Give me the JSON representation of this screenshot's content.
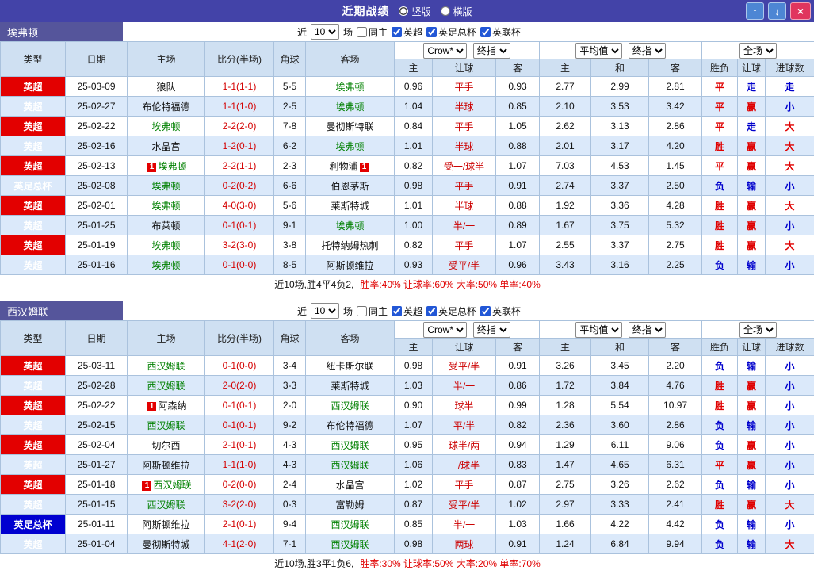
{
  "titlebar": {
    "title": "近期战绩",
    "vertical_label": "竖版",
    "horizontal_label": "横版",
    "vertical_checked": true,
    "horizontal_checked": false,
    "up_icon": "↑",
    "down_icon": "↓",
    "close_icon": "×"
  },
  "filter": {
    "near_label": "近",
    "count": "10",
    "games_label": "场",
    "same_home_label": "同主",
    "same_home_checked": false,
    "leagues": [
      {
        "label": "英超",
        "checked": true
      },
      {
        "label": "英足总杯",
        "checked": true
      },
      {
        "label": "英联杯",
        "checked": true
      }
    ]
  },
  "selects": {
    "asian_company": "Crow*",
    "asian_time": "终指",
    "euro_company": "平均值",
    "euro_time": "终指",
    "scope": "全场"
  },
  "columns": [
    "类型",
    "日期",
    "主场",
    "比分(半场)",
    "角球",
    "客场",
    "主",
    "让球",
    "客",
    "主",
    "和",
    "客",
    "胜负",
    "让球",
    "进球数"
  ],
  "colors": {
    "titlebar_bg": "#4343a8",
    "team_band_bg": "#55559b",
    "header_bg": "#cfe0f2",
    "alt_row_bg": "#dbe9fa",
    "league_red": "#e30000",
    "league_blue": "#0000d0",
    "focus_team_green": "#008000",
    "score_red": "#d40000",
    "handicap_red": "#cc0000",
    "result_red": "#e00000",
    "result_blue": "#0000cc"
  },
  "result_colors": {
    "胜": "#e00000",
    "平": "#e00000",
    "负": "#0000cc",
    "赢": "#e00000",
    "输": "#0000cc",
    "走": "#0000cc",
    "大": "#e00000",
    "小": "#0000cc"
  },
  "sections": [
    {
      "team": "埃弗顿",
      "rows": [
        {
          "league": "英超",
          "league_color": "red",
          "date": "25-03-09",
          "home": "狼队",
          "home_focus": false,
          "home_card": "",
          "score": "1-1(1-1)",
          "corners": "5-5",
          "away": "埃弗顿",
          "away_focus": true,
          "away_card": "",
          "asian_home": "0.96",
          "handicap": "平手",
          "asian_away": "0.93",
          "euro_home": "2.77",
          "euro_draw": "2.99",
          "euro_away": "2.81",
          "result": "平",
          "handicap_result": "走",
          "goals_result": "走"
        },
        {
          "league": "英超",
          "league_color": "red",
          "date": "25-02-27",
          "home": "布伦特福德",
          "home_focus": false,
          "home_card": "",
          "score": "1-1(1-0)",
          "corners": "2-5",
          "away": "埃弗顿",
          "away_focus": true,
          "away_card": "",
          "asian_home": "1.04",
          "handicap": "半球",
          "asian_away": "0.85",
          "euro_home": "2.10",
          "euro_draw": "3.53",
          "euro_away": "3.42",
          "result": "平",
          "handicap_result": "赢",
          "goals_result": "小"
        },
        {
          "league": "英超",
          "league_color": "red",
          "date": "25-02-22",
          "home": "埃弗顿",
          "home_focus": true,
          "home_card": "",
          "score": "2-2(2-0)",
          "corners": "7-8",
          "away": "曼彻斯特联",
          "away_focus": false,
          "away_card": "",
          "asian_home": "0.84",
          "handicap": "平手",
          "asian_away": "1.05",
          "euro_home": "2.62",
          "euro_draw": "3.13",
          "euro_away": "2.86",
          "result": "平",
          "handicap_result": "走",
          "goals_result": "大"
        },
        {
          "league": "英超",
          "league_color": "red",
          "date": "25-02-16",
          "home": "水晶宫",
          "home_focus": false,
          "home_card": "",
          "score": "1-2(0-1)",
          "corners": "6-2",
          "away": "埃弗顿",
          "away_focus": true,
          "away_card": "",
          "asian_home": "1.01",
          "handicap": "半球",
          "asian_away": "0.88",
          "euro_home": "2.01",
          "euro_draw": "3.17",
          "euro_away": "4.20",
          "result": "胜",
          "handicap_result": "赢",
          "goals_result": "大"
        },
        {
          "league": "英超",
          "league_color": "red",
          "date": "25-02-13",
          "home": "埃弗顿",
          "home_focus": true,
          "home_card": "1",
          "score": "2-2(1-1)",
          "corners": "2-3",
          "away": "利物浦",
          "away_focus": false,
          "away_card": "1",
          "asian_home": "0.82",
          "handicap": "受一/球半",
          "asian_away": "1.07",
          "euro_home": "7.03",
          "euro_draw": "4.53",
          "euro_away": "1.45",
          "result": "平",
          "handicap_result": "赢",
          "goals_result": "大"
        },
        {
          "league": "英足总杯",
          "league_color": "blue",
          "date": "25-02-08",
          "home": "埃弗顿",
          "home_focus": true,
          "home_card": "",
          "score": "0-2(0-2)",
          "corners": "6-6",
          "away": "伯恩茅斯",
          "away_focus": false,
          "away_card": "",
          "asian_home": "0.98",
          "handicap": "平手",
          "asian_away": "0.91",
          "euro_home": "2.74",
          "euro_draw": "3.37",
          "euro_away": "2.50",
          "result": "负",
          "handicap_result": "输",
          "goals_result": "小"
        },
        {
          "league": "英超",
          "league_color": "red",
          "date": "25-02-01",
          "home": "埃弗顿",
          "home_focus": true,
          "home_card": "",
          "score": "4-0(3-0)",
          "corners": "5-6",
          "away": "莱斯特城",
          "away_focus": false,
          "away_card": "",
          "asian_home": "1.01",
          "handicap": "半球",
          "asian_away": "0.88",
          "euro_home": "1.92",
          "euro_draw": "3.36",
          "euro_away": "4.28",
          "result": "胜",
          "handicap_result": "赢",
          "goals_result": "大"
        },
        {
          "league": "英超",
          "league_color": "red",
          "date": "25-01-25",
          "home": "布莱顿",
          "home_focus": false,
          "home_card": "",
          "score": "0-1(0-1)",
          "corners": "9-1",
          "away": "埃弗顿",
          "away_focus": true,
          "away_card": "",
          "asian_home": "1.00",
          "handicap": "半/一",
          "asian_away": "0.89",
          "euro_home": "1.67",
          "euro_draw": "3.75",
          "euro_away": "5.32",
          "result": "胜",
          "handicap_result": "赢",
          "goals_result": "小"
        },
        {
          "league": "英超",
          "league_color": "red",
          "date": "25-01-19",
          "home": "埃弗顿",
          "home_focus": true,
          "home_card": "",
          "score": "3-2(3-0)",
          "corners": "3-8",
          "away": "托特纳姆热刺",
          "away_focus": false,
          "away_card": "",
          "asian_home": "0.82",
          "handicap": "平手",
          "asian_away": "1.07",
          "euro_home": "2.55",
          "euro_draw": "3.37",
          "euro_away": "2.75",
          "result": "胜",
          "handicap_result": "赢",
          "goals_result": "大"
        },
        {
          "league": "英超",
          "league_color": "red",
          "date": "25-01-16",
          "home": "埃弗顿",
          "home_focus": true,
          "home_card": "",
          "score": "0-1(0-0)",
          "corners": "8-5",
          "away": "阿斯顿维拉",
          "away_focus": false,
          "away_card": "",
          "asian_home": "0.93",
          "handicap": "受平/半",
          "asian_away": "0.96",
          "euro_home": "3.43",
          "euro_draw": "3.16",
          "euro_away": "2.25",
          "result": "负",
          "handicap_result": "输",
          "goals_result": "小"
        }
      ],
      "summary": {
        "lead": "近10场,胜4平4负2,",
        "stats": "胜率:40% 让球率:60% 大率:50% 单率:40%"
      }
    },
    {
      "team": "西汉姆联",
      "rows": [
        {
          "league": "英超",
          "league_color": "red",
          "date": "25-03-11",
          "home": "西汉姆联",
          "home_focus": true,
          "home_card": "",
          "score": "0-1(0-0)",
          "corners": "3-4",
          "away": "纽卡斯尔联",
          "away_focus": false,
          "away_card": "",
          "asian_home": "0.98",
          "handicap": "受平/半",
          "asian_away": "0.91",
          "euro_home": "3.26",
          "euro_draw": "3.45",
          "euro_away": "2.20",
          "result": "负",
          "handicap_result": "输",
          "goals_result": "小"
        },
        {
          "league": "英超",
          "league_color": "red",
          "date": "25-02-28",
          "home": "西汉姆联",
          "home_focus": true,
          "home_card": "",
          "score": "2-0(2-0)",
          "corners": "3-3",
          "away": "莱斯特城",
          "away_focus": false,
          "away_card": "",
          "asian_home": "1.03",
          "handicap": "半/一",
          "asian_away": "0.86",
          "euro_home": "1.72",
          "euro_draw": "3.84",
          "euro_away": "4.76",
          "result": "胜",
          "handicap_result": "赢",
          "goals_result": "小"
        },
        {
          "league": "英超",
          "league_color": "red",
          "date": "25-02-22",
          "home": "阿森纳",
          "home_focus": false,
          "home_card": "1",
          "score": "0-1(0-1)",
          "corners": "2-0",
          "away": "西汉姆联",
          "away_focus": true,
          "away_card": "",
          "asian_home": "0.90",
          "handicap": "球半",
          "asian_away": "0.99",
          "euro_home": "1.28",
          "euro_draw": "5.54",
          "euro_away": "10.97",
          "result": "胜",
          "handicap_result": "赢",
          "goals_result": "小"
        },
        {
          "league": "英超",
          "league_color": "red",
          "date": "25-02-15",
          "home": "西汉姆联",
          "home_focus": true,
          "home_card": "",
          "score": "0-1(0-1)",
          "corners": "9-2",
          "away": "布伦特福德",
          "away_focus": false,
          "away_card": "",
          "asian_home": "1.07",
          "handicap": "平/半",
          "asian_away": "0.82",
          "euro_home": "2.36",
          "euro_draw": "3.60",
          "euro_away": "2.86",
          "result": "负",
          "handicap_result": "输",
          "goals_result": "小"
        },
        {
          "league": "英超",
          "league_color": "red",
          "date": "25-02-04",
          "home": "切尔西",
          "home_focus": false,
          "home_card": "",
          "score": "2-1(0-1)",
          "corners": "4-3",
          "away": "西汉姆联",
          "away_focus": true,
          "away_card": "",
          "asian_home": "0.95",
          "handicap": "球半/两",
          "asian_away": "0.94",
          "euro_home": "1.29",
          "euro_draw": "6.11",
          "euro_away": "9.06",
          "result": "负",
          "handicap_result": "赢",
          "goals_result": "小"
        },
        {
          "league": "英超",
          "league_color": "red",
          "date": "25-01-27",
          "home": "阿斯顿维拉",
          "home_focus": false,
          "home_card": "",
          "score": "1-1(1-0)",
          "corners": "4-3",
          "away": "西汉姆联",
          "away_focus": true,
          "away_card": "",
          "asian_home": "1.06",
          "handicap": "一/球半",
          "asian_away": "0.83",
          "euro_home": "1.47",
          "euro_draw": "4.65",
          "euro_away": "6.31",
          "result": "平",
          "handicap_result": "赢",
          "goals_result": "小"
        },
        {
          "league": "英超",
          "league_color": "red",
          "date": "25-01-18",
          "home": "西汉姆联",
          "home_focus": true,
          "home_card": "1",
          "score": "0-2(0-0)",
          "corners": "2-4",
          "away": "水晶宫",
          "away_focus": false,
          "away_card": "",
          "asian_home": "1.02",
          "handicap": "平手",
          "asian_away": "0.87",
          "euro_home": "2.75",
          "euro_draw": "3.26",
          "euro_away": "2.62",
          "result": "负",
          "handicap_result": "输",
          "goals_result": "小"
        },
        {
          "league": "英超",
          "league_color": "red",
          "date": "25-01-15",
          "home": "西汉姆联",
          "home_focus": true,
          "home_card": "",
          "score": "3-2(2-0)",
          "corners": "0-3",
          "away": "富勒姆",
          "away_focus": false,
          "away_card": "",
          "asian_home": "0.87",
          "handicap": "受平/半",
          "asian_away": "1.02",
          "euro_home": "2.97",
          "euro_draw": "3.33",
          "euro_away": "2.41",
          "result": "胜",
          "handicap_result": "赢",
          "goals_result": "大"
        },
        {
          "league": "英足总杯",
          "league_color": "blue",
          "date": "25-01-11",
          "home": "阿斯顿维拉",
          "home_focus": false,
          "home_card": "",
          "score": "2-1(0-1)",
          "corners": "9-4",
          "away": "西汉姆联",
          "away_focus": true,
          "away_card": "",
          "asian_home": "0.85",
          "handicap": "半/一",
          "asian_away": "1.03",
          "euro_home": "1.66",
          "euro_draw": "4.22",
          "euro_away": "4.42",
          "result": "负",
          "handicap_result": "输",
          "goals_result": "小"
        },
        {
          "league": "英超",
          "league_color": "red",
          "date": "25-01-04",
          "home": "曼彻斯特城",
          "home_focus": false,
          "home_card": "",
          "score": "4-1(2-0)",
          "corners": "7-1",
          "away": "西汉姆联",
          "away_focus": true,
          "away_card": "",
          "asian_home": "0.98",
          "handicap": "两球",
          "asian_away": "0.91",
          "euro_home": "1.24",
          "euro_draw": "6.84",
          "euro_away": "9.94",
          "result": "负",
          "handicap_result": "输",
          "goals_result": "大"
        }
      ],
      "summary": {
        "lead": "近10场,胜3平1负6,",
        "stats": "胜率:30% 让球率:50% 大率:20% 单率:70%"
      }
    }
  ]
}
